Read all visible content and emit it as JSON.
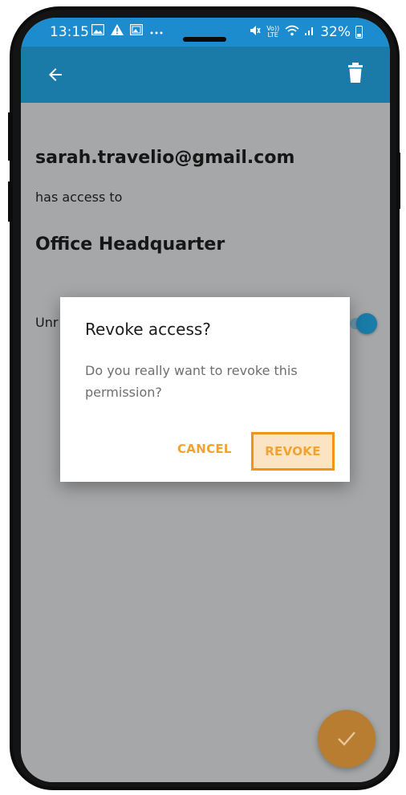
{
  "status_bar": {
    "time": "13:15",
    "left_icons": [
      "gallery-icon",
      "warning-icon",
      "image-icon",
      "more-dots-icon"
    ],
    "right_icons": [
      "mute-icon",
      "volte-icon",
      "wifi-icon",
      "signal-icon"
    ],
    "volte_label": "Vo)) LTE",
    "battery": "32%"
  },
  "app_bar": {
    "back_icon": "arrow-left-icon",
    "delete_icon": "trash-icon",
    "color": "#1a7aa8"
  },
  "content": {
    "email": "sarah.travelio@gmail.com",
    "subtitle": "has access to",
    "location": "Office Headquarter",
    "setting_label": "Unr",
    "toggle_on": true
  },
  "dialog": {
    "title": "Revoke access?",
    "message": "Do you really want to revoke this permission?",
    "cancel_label": "CANCEL",
    "revoke_label": "REVOKE",
    "accent": "#f2a32f",
    "highlight_border": "#f29219"
  },
  "fab": {
    "icon": "check-icon",
    "color": "#b87d31"
  }
}
